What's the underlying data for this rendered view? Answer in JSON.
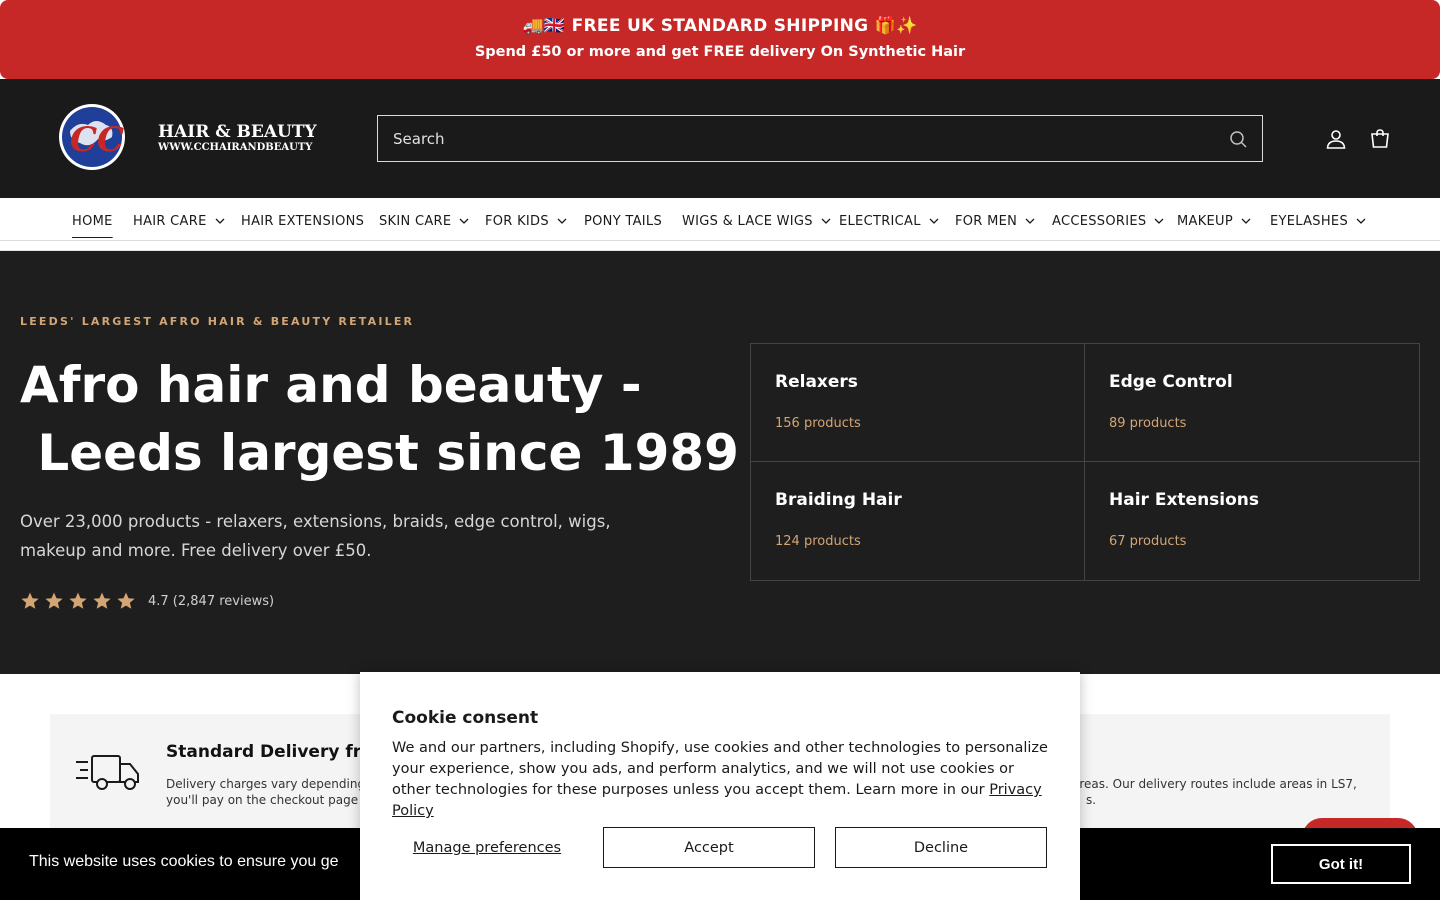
{
  "announcement": {
    "line1": "🚚🇬🇧 FREE UK STANDARD SHIPPING 🎁✨",
    "line2": "Spend £50 or more and get FREE delivery On Synthetic Hair"
  },
  "header": {
    "logo_text": "HAIR & BEAUTY",
    "logo_url": "WWW.CCHAIRANDBEAUTY",
    "logo_initials": "CC",
    "search_placeholder": "Search"
  },
  "nav": {
    "items": [
      {
        "label": "HOME",
        "dropdown": false,
        "active": true
      },
      {
        "label": "HAIR CARE",
        "dropdown": true
      },
      {
        "label": "HAIR EXTENSIONS",
        "dropdown": false
      },
      {
        "label": "SKIN CARE",
        "dropdown": true
      },
      {
        "label": "FOR KIDS",
        "dropdown": true
      },
      {
        "label": "PONY TAILS",
        "dropdown": false
      },
      {
        "label": "WIGS & LACE WIGS",
        "dropdown": true
      },
      {
        "label": "ELECTRICAL",
        "dropdown": true
      },
      {
        "label": "FOR MEN",
        "dropdown": true
      },
      {
        "label": "ACCESSORIES",
        "dropdown": true
      },
      {
        "label": "MAKEUP",
        "dropdown": true
      },
      {
        "label": "EYELASHES",
        "dropdown": true
      }
    ]
  },
  "hero": {
    "eyebrow": "LEEDS' LARGEST AFRO HAIR & BEAUTY RETAILER",
    "heading_line1": "Afro hair and beauty -",
    "heading_line2": " Leeds largest since 1989",
    "description": "Over 23,000 products - relaxers, extensions, braids, edge control, wigs, makeup and more. Free delivery over £50.",
    "rating_stars": 5,
    "rating_text": "4.7 (2,847 reviews)",
    "categories": [
      {
        "title": "Relaxers",
        "count": "156 products"
      },
      {
        "title": "Edge Control",
        "count": "89 products"
      },
      {
        "title": "Braiding Hair",
        "count": "124 products"
      },
      {
        "title": "Hair Extensions",
        "count": "67 products"
      }
    ]
  },
  "delivery": {
    "title": "Standard Delivery from",
    "text_left_line1": "Delivery charges vary depending",
    "text_left_line2": "you'll pay on the checkout page",
    "text_right_line1": "areas. Our delivery routes include areas in LS7,",
    "text_right_line2": "s."
  },
  "cookie_bar": {
    "text": "This website uses cookies to ensure you ge",
    "button": "Got it!"
  },
  "cookie_modal": {
    "title": "Cookie consent",
    "body": "We and our partners, including Shopify, use cookies and other technologies to personalize your experience, show you ads, and perform analytics, and we will not use cookies or other technologies for these purposes unless you accept them. Learn more in our ",
    "link": "Privacy Policy",
    "manage": "Manage preferences",
    "accept": "Accept",
    "decline": "Decline"
  },
  "colors": {
    "announcement_bg": "#c62828",
    "header_bg": "#1a1a1a",
    "hero_bg": "#1e1e1e",
    "accent_gold": "#d4a574",
    "star_color": "#d4a574"
  }
}
